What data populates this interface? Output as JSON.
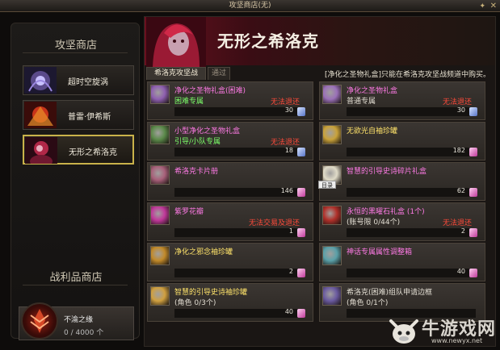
{
  "window": {
    "title": "攻坚商店(无)",
    "pin_icon": "pin-icon",
    "close_icon": "close-icon"
  },
  "sidebar": {
    "shop_heading": "攻坚商店",
    "items": [
      {
        "label": "超时空旋涡",
        "icon": "vortex-thumb",
        "active": false
      },
      {
        "label": "普雷·伊希斯",
        "icon": "isys-thumb",
        "active": false
      },
      {
        "label": "无形之希洛克",
        "icon": "siroco-thumb",
        "active": true
      }
    ],
    "loot_heading": "战利品商店",
    "loot": {
      "name": "不渝之缘",
      "count": "0 / 4000 个",
      "icon": "loot-emblem-icon"
    }
  },
  "main": {
    "title": "无形之希洛克",
    "tabs": [
      {
        "label": "希洛克攻坚战",
        "active": true
      },
      {
        "label": "通过",
        "active": false
      }
    ],
    "notice": "[净化之圣物礼盒]只能在希洛克攻坚战频道中购买。",
    "items": [
      {
        "name": "净化之圣物礼盒(困难)",
        "name_color": "#ff7ae6",
        "sub": "困难专属",
        "sub_color": "#7cff6a",
        "tag": "无法退还",
        "price": "30",
        "coin": "blue",
        "icon_color": "#8e5fb0"
      },
      {
        "name": "净化之圣物礼盒",
        "name_color": "#ff7ae6",
        "sub": "普通专属",
        "sub_color": "#e2ddd2",
        "tag": "无法退还",
        "price": "30",
        "coin": "blue",
        "icon_color": "#9a70b8"
      },
      {
        "name": "小型净化之圣物礼盒",
        "name_color": "#ff7ae6",
        "sub": "引导/小队专属",
        "sub_color": "#7cff6a",
        "tag": "无法退还",
        "price": "18",
        "coin": "blue",
        "icon_color": "#5b8a4a"
      },
      {
        "name": "无欲光自袖珍罐",
        "name_color": "#ffe36a",
        "sub": "",
        "sub_color": "#e2ddd2",
        "tag": "",
        "price": "182",
        "coin": "pink",
        "icon_color": "#c9a23a"
      },
      {
        "name": "希洛克卡片册",
        "name_color": "#ff7ae6",
        "sub": "",
        "sub_color": "#e2ddd2",
        "tag": "",
        "price": "146",
        "coin": "pink",
        "icon_color": "#a8607a"
      },
      {
        "name": "智慧的引导史诗碎片礼盒",
        "name_color": "#ff7ae6",
        "sub": "",
        "sub_color": "#e2ddd2",
        "tag": "",
        "price": "62",
        "coin": "pink",
        "icon_color": "#e0dbc8",
        "preview": "目录"
      },
      {
        "name": "紫罗花瓣",
        "name_color": "#ff7ae6",
        "sub": "",
        "sub_color": "#e2ddd2",
        "tag": "无法交易及退还",
        "price": "1",
        "coin": "pink",
        "icon_color": "#c0389a"
      },
      {
        "name": "永恒的黑曜石礼盒 (1个)",
        "name_color": "#ff7ae6",
        "sub": "(账号限 0/44个)",
        "sub_color": "#e2ddd2",
        "tag": "无法退还",
        "price": "2",
        "coin": "pink",
        "icon_color": "#b0302a"
      },
      {
        "name": "净化之邪念袖珍罐",
        "name_color": "#ffe36a",
        "sub": "",
        "sub_color": "#e2ddd2",
        "tag": "",
        "price": "2",
        "coin": "pink",
        "icon_color": "#c28a2a"
      },
      {
        "name": "神话专属属性调整箱",
        "name_color": "#ff7ae6",
        "sub": "",
        "sub_color": "#e2ddd2",
        "tag": "",
        "price": "40",
        "coin": "pink",
        "icon_color": "#5aa0a8"
      },
      {
        "name": "智慧的引导史诗袖珍罐",
        "name_color": "#ffe36a",
        "sub": "(角色 0/3个)",
        "sub_color": "#e2ddd2",
        "tag": "",
        "price": "40",
        "coin": "pink",
        "icon_color": "#d0a040"
      },
      {
        "name": "希洛克(困难)组队申请边框",
        "name_color": "#e2ddd2",
        "sub": "(角色 0/1个)",
        "sub_color": "#e2ddd2",
        "tag": "",
        "price": "",
        "coin": "",
        "icon_color": "#6a5aa0"
      }
    ]
  },
  "watermark": {
    "text": "牛游戏网",
    "url": "www.newyx.net",
    "icon": "cow-logo-icon"
  }
}
